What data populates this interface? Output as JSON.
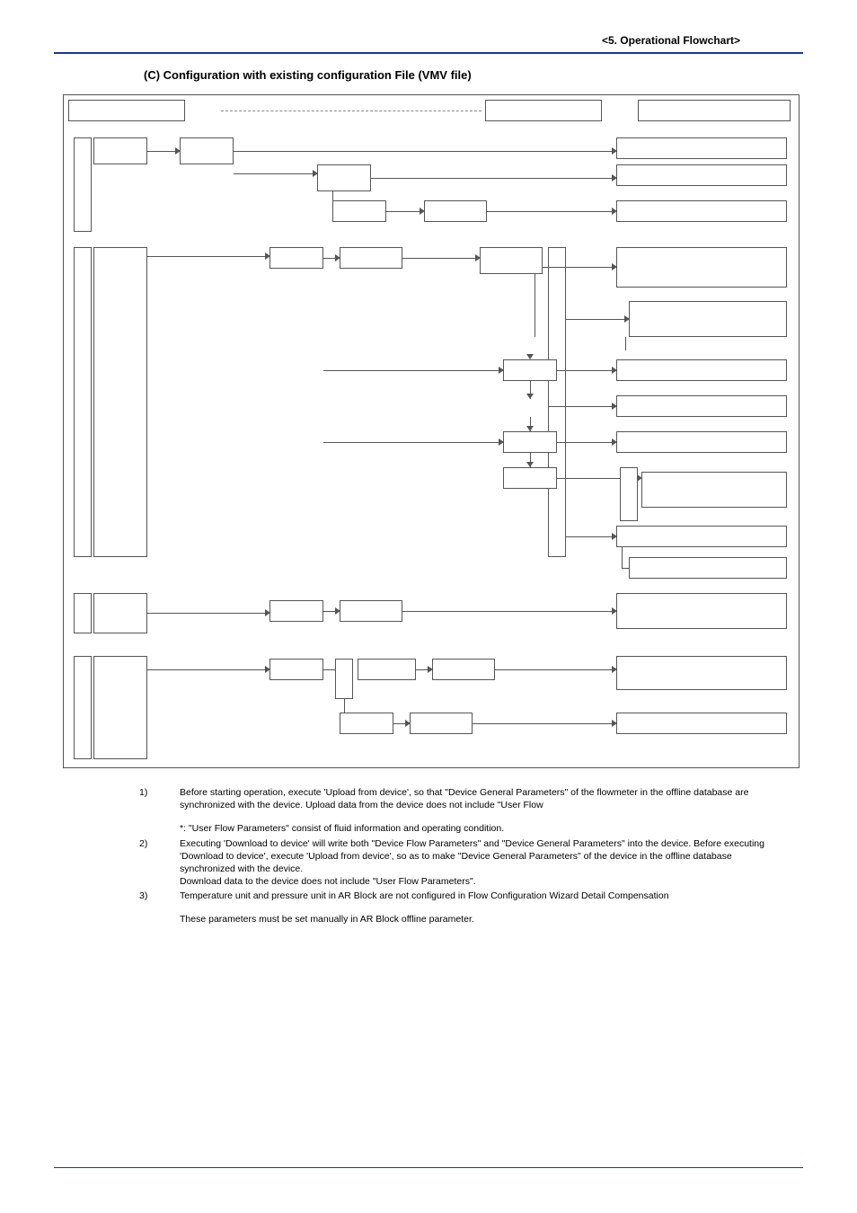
{
  "header": "<5.  Operational Flowchart>",
  "section_title": "(C)   Configuration with existing configuration File (VMV file)",
  "notes": [
    {
      "num": "1)",
      "text": "Before starting operation, execute 'Upload from device', so that \"Device General Parameters\" of the flowmeter in the offline database are synchronized with the device. Upload data from the device does not include \"User Flow"
    },
    {
      "num": "",
      "text": "*: \"User Flow Parameters\" consist of fluid information and operating condition."
    },
    {
      "num": "2)",
      "text": "Executing 'Download to device' will write both \"Device Flow Parameters\" and \"Device General Parameters\" into the device. Before executing 'Download to device', execute 'Upload from device', so as to make \"Device General Parameters\" of the device in the offline database synchronized with the device.\nDownload data to the device does not include \"User Flow Parameters\"."
    },
    {
      "num": "3)",
      "text": "Temperature unit and pressure unit in AR Block are not configured in Flow Configuration Wizard Detail Compensation"
    },
    {
      "num": "",
      "text": "These parameters must be set manually in AR Block offline parameter."
    }
  ]
}
